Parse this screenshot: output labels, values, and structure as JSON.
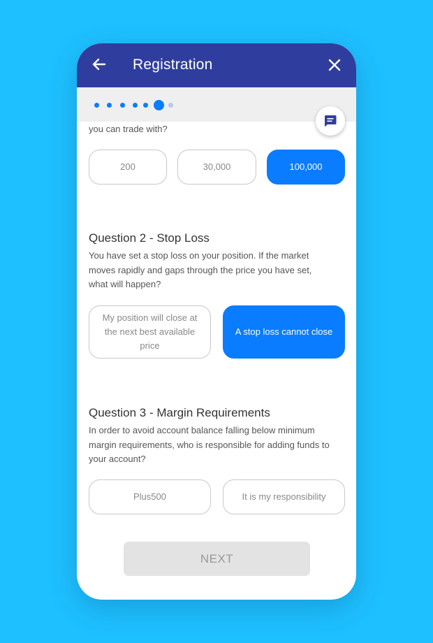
{
  "header": {
    "title": "Registration",
    "back_icon": "arrow-left-icon",
    "close_icon": "close-icon",
    "background": "#2f3e9e"
  },
  "progress": {
    "total_steps": 7,
    "current_step": 6
  },
  "chat_icon": "chat-bubble-icon",
  "question1": {
    "text_fragment": "you can trade with?",
    "options": [
      "200",
      "30,000",
      "100,000"
    ],
    "selected": "100,000"
  },
  "question2": {
    "title": "Question 2 - Stop Loss",
    "text": "You have set a stop loss on your position. If the market moves rapidly and gaps through the price you have set, what will happen?",
    "options": [
      "My position will close at the next best available price",
      "A stop loss cannot close"
    ],
    "selected": "A stop loss cannot close"
  },
  "question3": {
    "title": "Question 3 - Margin Requirements",
    "text": "In order to avoid account balance falling below minimum margin requirements, who is responsible for adding funds to your account?",
    "options": [
      "Plus500",
      "It is my responsibility"
    ],
    "selected": null
  },
  "next_button": {
    "label": "NEXT",
    "enabled": false
  },
  "colors": {
    "accent": "#0a7cff",
    "background": "#1ec0ff"
  }
}
